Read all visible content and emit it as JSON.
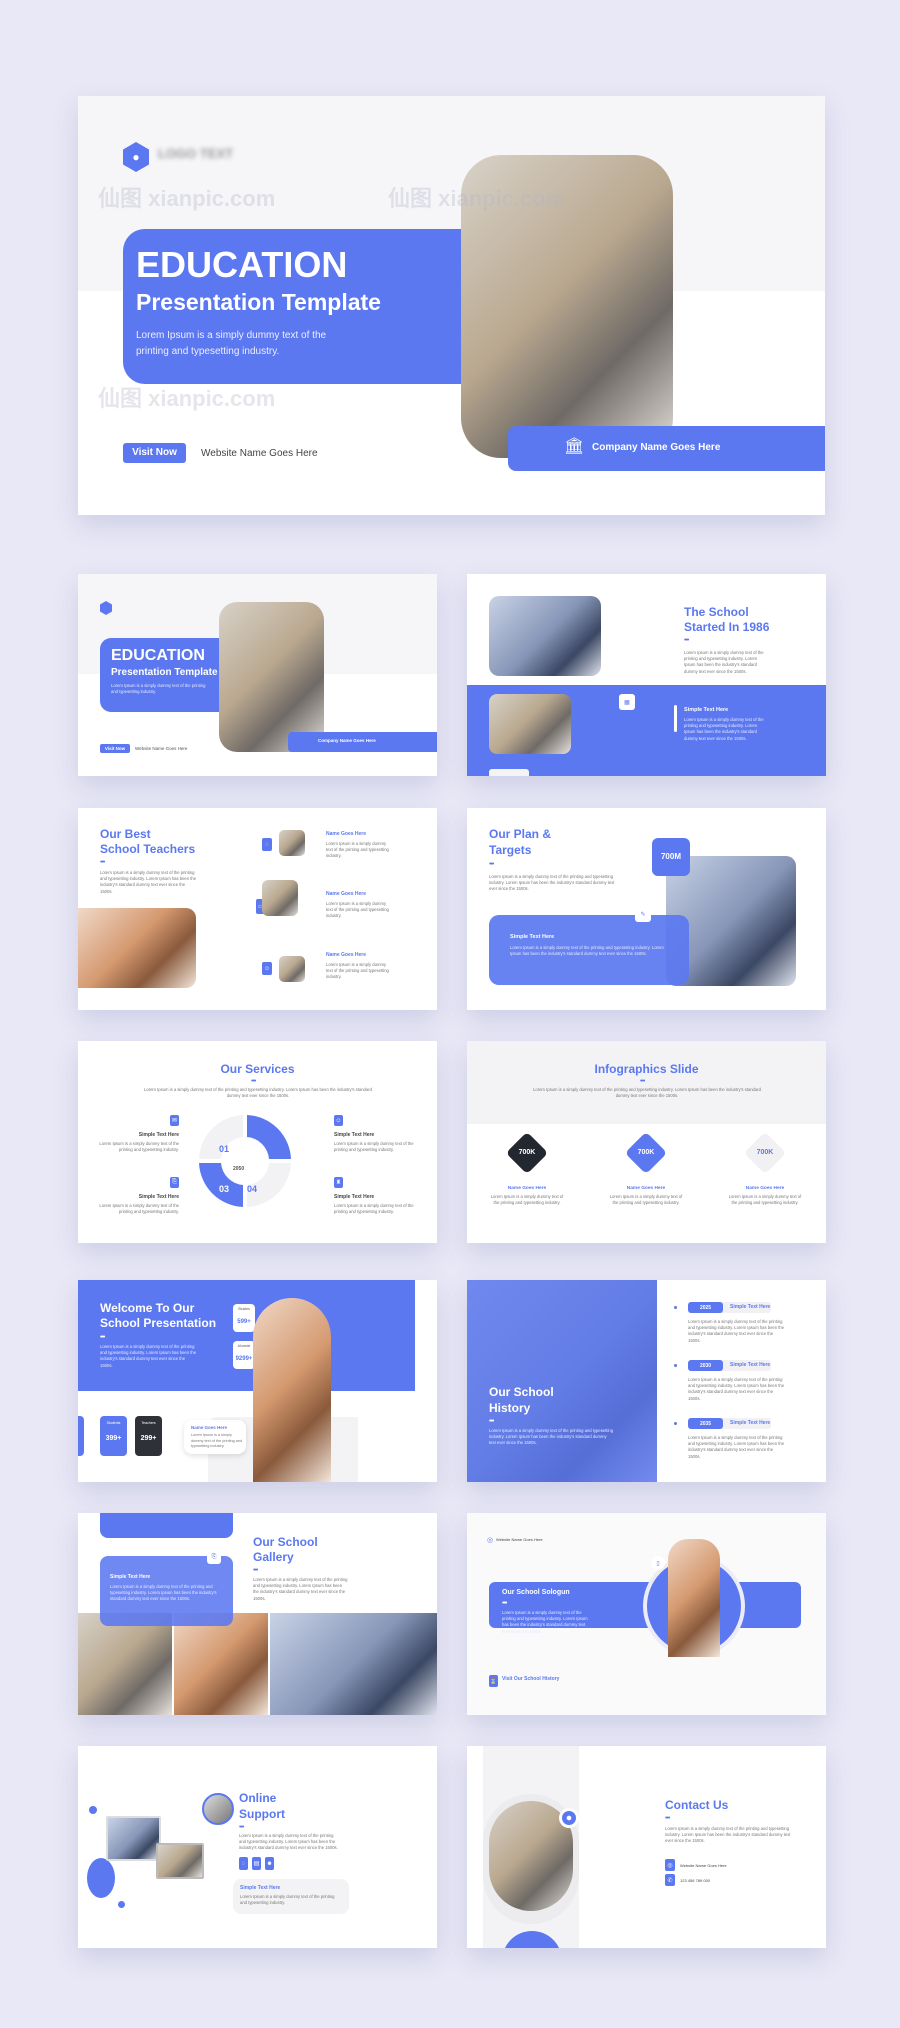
{
  "colors": {
    "accent": "#5b78f0",
    "dark": "#23272f",
    "background": "#e8e8f6"
  },
  "watermark": "仙图 xianpic.com",
  "lorem_short": "Lorem Ipsum is a simply dummy text of the printing and typesetting industry.",
  "lorem_long": "Lorem Ipsum is a simply dummy text of the printing and typesetting industry. Lorem Ipsum has been the industry's standard dummy text ever since the 1500s.",
  "cover": {
    "logo_text": "LOGO TEXT",
    "title": "EDUCATION",
    "subtitle": "Presentation Template",
    "desc": "Lorem Ipsum is a simply dummy text of the printing and typesetting industry.",
    "visit_btn": "Visit Now",
    "website": "Website Name Goes Here",
    "company": "Company Name Goes Here",
    "company_icon": "bank-icon",
    "logo_icon": "drop-hexagon-icon"
  },
  "school_started": {
    "title_1": "The School",
    "title_2": "Started In 1986",
    "card_title": "Simple Text Here"
  },
  "teachers": {
    "title_1": "Our Best",
    "title_2": "School Teachers",
    "names": [
      "Name Goes Here",
      "Name Goes Here",
      "Name Goes Here"
    ],
    "person_desc": "Lorem Ipsum is a simply dummy text of the printing and typesetting industry."
  },
  "plan": {
    "title_1": "Our Plan &",
    "title_2": "Targets",
    "badge": "700M",
    "card_title": "Simple Text Here"
  },
  "services": {
    "title": "Our Services",
    "center": "2050",
    "segments": [
      "01",
      "02",
      "03",
      "04"
    ],
    "items": [
      "Simple Text Here",
      "Simple Text Here",
      "Simple Text Here",
      "Simple Text Here"
    ],
    "item_desc": "Lorem Ipsum is a simply dummy text of the printing and typesetting industry."
  },
  "infographics": {
    "title": "Infographics Slide",
    "items": [
      {
        "value": "700K",
        "name": "Name Goes Here"
      },
      {
        "value": "700K",
        "name": "Name Goes Here"
      },
      {
        "value": "700K",
        "name": "Name Goes Here"
      }
    ],
    "item_desc": "Lorem Ipsum is a simply dummy text of the printing and typesetting industry."
  },
  "welcome": {
    "title_1": "Welcome To Our",
    "title_2": "School Presentation",
    "stats": [
      {
        "label": "Studies",
        "value": "599+"
      },
      {
        "label": "Alumnie",
        "value": "9299+"
      },
      {
        "label": "Students",
        "value": "399+"
      },
      {
        "label": "Teachers",
        "value": "299+"
      }
    ],
    "card_name": "Name Goes Here",
    "card_desc": "Lorem Ipsum is a simply dummy text of the printing and typesetting industry."
  },
  "history": {
    "title_1": "Our School",
    "title_2": "History",
    "timeline": [
      {
        "year": "2025",
        "label": "Simple Text Here"
      },
      {
        "year": "2030",
        "label": "Simple Text Here"
      },
      {
        "year": "2035",
        "label": "Simple Text Here"
      }
    ]
  },
  "gallery": {
    "title_1": "Our School",
    "title_2": "Gallery",
    "card_title": "Simple Text Here"
  },
  "slogan": {
    "website": "Website Name Goes Here",
    "title": "Our School Sologun",
    "link": "Visit Our School History"
  },
  "support": {
    "title_1": "Online",
    "title_2": "Support",
    "card_title": "Simple Text Here"
  },
  "contact": {
    "title": "Contact Us",
    "website": "Website Name Goes Here",
    "phone": "123 456 789 000"
  }
}
